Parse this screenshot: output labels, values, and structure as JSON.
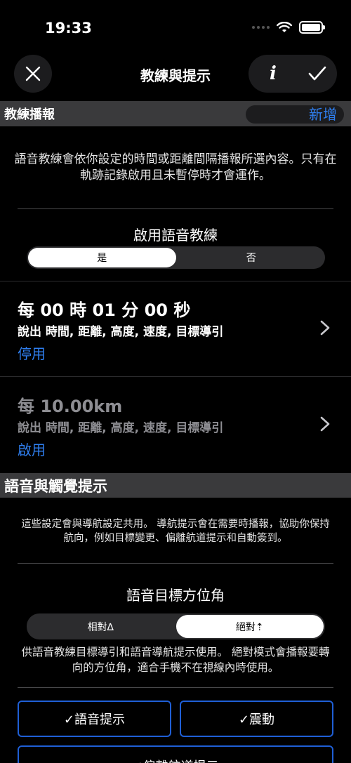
{
  "status": {
    "time": "19:33"
  },
  "nav": {
    "title": "教練與提示",
    "info_label": "i"
  },
  "coach_section": {
    "title": "教練播報",
    "add_label": "新增",
    "description": "語音教練會依你設定的時間或距離間隔播報所選內容。只有在軌跡記錄啟用且未暫停時才會運作。",
    "enable_label": "啟用語音教練",
    "enable_options": [
      "是",
      "否"
    ],
    "enable_selected": "是",
    "items": [
      {
        "interval": "每 00 時 01 分 00 秒",
        "speaks": "說出 時間, 距離, 高度, 速度, 目標導引",
        "action": "停用"
      },
      {
        "interval": "每 10.00km",
        "speaks": "說出 時間, 距離, 高度, 速度, 目標導引",
        "action": "啟用"
      }
    ]
  },
  "voice_section": {
    "title": "語音與觸覺提示",
    "description": "這些設定會與導航設定共用。 導航提示會在需要時播報，協助你保持航向，例如目標變更、偏離航道提示和自動簽到。",
    "bearing_label": "語音目標方位角",
    "bearing_options": [
      "相對∆",
      "絕對⇡"
    ],
    "bearing_selected": "絕對⇡",
    "bearing_description": "供語音教練目標導引和語音導航提示使用。 絕對模式會播報要轉向的方位角，適合手機不在視線內時使用。",
    "toggles": [
      "✓語音提示",
      "✓震動",
      "✓偏離航道提示"
    ]
  },
  "colors": {
    "accent": "#2f7ff0",
    "section_header": "#3a3a3c",
    "background": "#000000"
  }
}
